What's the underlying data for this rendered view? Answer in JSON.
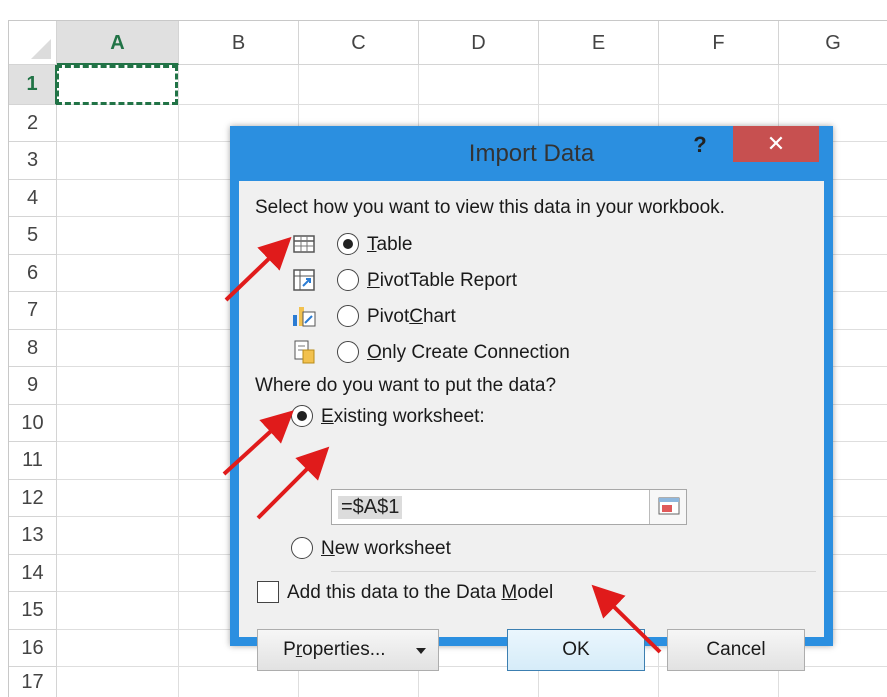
{
  "sheet": {
    "columns": [
      "A",
      "B",
      "C",
      "D",
      "E",
      "F",
      "G"
    ],
    "rows": [
      "1",
      "2",
      "3",
      "4",
      "5",
      "6",
      "7",
      "8",
      "9",
      "10",
      "11",
      "12",
      "13",
      "14",
      "15",
      "16",
      "17"
    ],
    "selected_column": "A",
    "selected_row": "1"
  },
  "dialog": {
    "title": "Import Data",
    "help": "?",
    "close": "✕",
    "view_prompt": "Select how you want to view this data in your workbook.",
    "view_options": [
      {
        "label": "Table",
        "key": "T",
        "rest": "able",
        "selected": true,
        "icon": "table-icon"
      },
      {
        "label": "PivotTable Report",
        "key": "P",
        "rest": "ivotTable Report",
        "selected": false,
        "icon": "pivottable-icon"
      },
      {
        "label": "PivotChart",
        "pre": "Pivot",
        "key": "C",
        "rest": "hart",
        "selected": false,
        "icon": "pivotchart-icon"
      },
      {
        "label": "Only Create Connection",
        "key": "O",
        "rest": "nly Create Connection",
        "selected": false,
        "icon": "connection-icon"
      }
    ],
    "location_prompt": "Where do you want to put the data?",
    "existing": {
      "key": "E",
      "rest": "xisting worksheet:",
      "selected": true
    },
    "reference": "=$A$1",
    "new_ws": {
      "key": "N",
      "rest": "ew worksheet",
      "selected": false
    },
    "data_model": {
      "pre": "Add this data to the Data ",
      "key": "M",
      "rest": "odel",
      "checked": false
    },
    "buttons": {
      "properties": {
        "pre": "P",
        "key": "r",
        "rest": "operties..."
      },
      "ok": "OK",
      "cancel": "Cancel"
    }
  },
  "colors": {
    "dialog_frame": "#2b8fe0",
    "close_button": "#c75050",
    "excel_green": "#217346",
    "annotation_arrow": "#e01b1b"
  }
}
